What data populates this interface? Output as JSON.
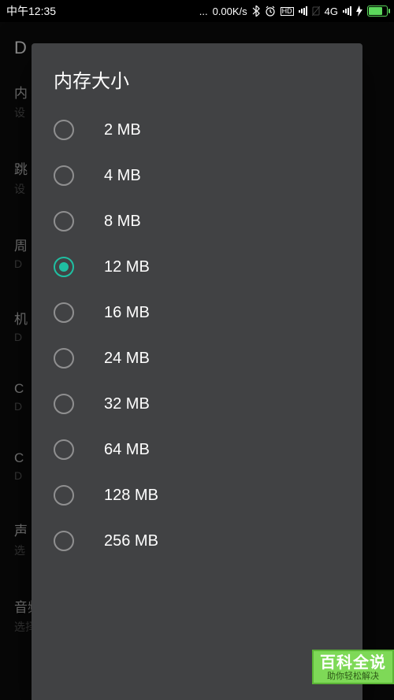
{
  "status": {
    "time": "中午12:35",
    "data_speed": "0.00K/s",
    "network_label": "4G",
    "hd_label": "HD"
  },
  "background": {
    "header": "D",
    "rows": [
      {
        "label": "内",
        "sub": "设"
      },
      {
        "label": "跳",
        "sub": "设"
      },
      {
        "label": "周",
        "sub": "D"
      },
      {
        "label": "机",
        "sub": "D"
      },
      {
        "label": "C",
        "sub": "D"
      },
      {
        "label": "C",
        "sub": "D"
      },
      {
        "label": "声",
        "sub": "选"
      },
      {
        "label": "音频...",
        "sub": "选择的音频采样率/质量"
      }
    ]
  },
  "dialog": {
    "title": "内存大小",
    "selected_index": 3,
    "options": [
      {
        "label": "2 MB"
      },
      {
        "label": "4 MB"
      },
      {
        "label": "8 MB"
      },
      {
        "label": "12 MB"
      },
      {
        "label": "16 MB"
      },
      {
        "label": "24 MB"
      },
      {
        "label": "32 MB"
      },
      {
        "label": "64 MB"
      },
      {
        "label": "128 MB"
      },
      {
        "label": "256 MB"
      }
    ]
  },
  "watermark": {
    "main": "百科全说",
    "sub": "助你轻松解决"
  }
}
